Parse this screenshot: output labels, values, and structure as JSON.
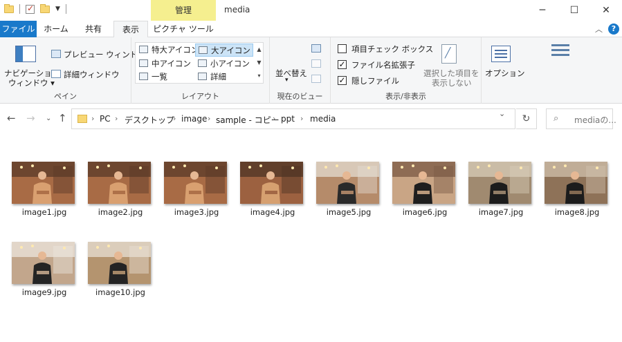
{
  "window": {
    "title": "media",
    "context_tab": "管理",
    "minimize_icon": "minimize-icon",
    "maximize_icon": "maximize-icon",
    "close_icon": "close-icon"
  },
  "tabs": {
    "file": "ファイル",
    "home": "ホーム",
    "share": "共有",
    "view": "表示",
    "picture_tools": "ピクチャ ツール"
  },
  "ribbon": {
    "pane": {
      "nav_pane_line1": "ナビゲーション",
      "nav_pane_line2": "ウィンドウ",
      "preview": "プレビュー ウィンドウ",
      "details": "詳細ウィンドウ",
      "label": "ペイン"
    },
    "layout": {
      "items": [
        "特大アイコン",
        "大アイコン",
        "中アイコン",
        "小アイコン",
        "一覧",
        "詳細"
      ],
      "selected": "大アイコン",
      "label": "レイアウト"
    },
    "current_view": {
      "sort": "並べ替え",
      "label": "現在のビュー"
    },
    "show_hide": {
      "item_checkbox": "項目チェック ボックス",
      "item_checkbox_checked": false,
      "extensions": "ファイル名拡張子",
      "extensions_checked": true,
      "hidden": "隠しファイル",
      "hidden_checked": true,
      "hide_selected_line1": "選択した項目を",
      "hide_selected_line2": "表示しない",
      "label": "表示/非表示"
    },
    "options": "オプション"
  },
  "address": {
    "crumbs": [
      "PC",
      "デスクトップ",
      "image",
      "sample - コピー",
      "ppt",
      "media"
    ],
    "search_placeholder": "mediaの..."
  },
  "files": [
    {
      "name": "image1.jpg",
      "colors": [
        "#5a3a28",
        "#a86b45",
        "#d9a070"
      ]
    },
    {
      "name": "image2.jpg",
      "colors": [
        "#5a3a28",
        "#a86b45",
        "#d9a070"
      ]
    },
    {
      "name": "image3.jpg",
      "colors": [
        "#5a3a28",
        "#a86b45",
        "#d9a070"
      ]
    },
    {
      "name": "image4.jpg",
      "colors": [
        "#4e3424",
        "#9c6140",
        "#d6a070"
      ]
    },
    {
      "name": "image5.jpg",
      "colors": [
        "#e4dcd2",
        "#b58b6a",
        "#2a2a2a"
      ]
    },
    {
      "name": "image6.jpg",
      "colors": [
        "#7a5a44",
        "#c9a585",
        "#1e1e1e"
      ]
    },
    {
      "name": "image7.jpg",
      "colors": [
        "#d8ccb8",
        "#a08a70",
        "#1c1c1c"
      ]
    },
    {
      "name": "image8.jpg",
      "colors": [
        "#d0c2ac",
        "#8e7258",
        "#1c1c1c"
      ]
    },
    {
      "name": "image9.jpg",
      "colors": [
        "#ece6de",
        "#c2a68c",
        "#242424"
      ]
    },
    {
      "name": "image10.jpg",
      "colors": [
        "#e8e0d4",
        "#b4946f",
        "#242424"
      ]
    }
  ]
}
